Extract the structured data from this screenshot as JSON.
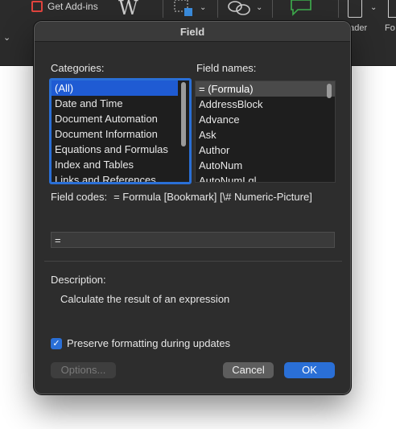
{
  "ribbon": {
    "add_ins_label": "Get Add-ins",
    "wikipedia_glyph": "W",
    "header_label": "eader",
    "footer_label": "Fo"
  },
  "dialog": {
    "title": "Field",
    "categories_label": "Categories:",
    "categories": [
      "(All)",
      "Date and Time",
      "Document Automation",
      "Document Information",
      "Equations and Formulas",
      "Index and Tables",
      "Links and References"
    ],
    "categories_selected": "(All)",
    "field_names_label": "Field names:",
    "field_names": [
      "= (Formula)",
      "AddressBlock",
      "Advance",
      "Ask",
      "Author",
      "AutoNum",
      "AutoNumLgl"
    ],
    "field_names_selected": "= (Formula)",
    "field_codes_label": "Field codes:",
    "field_codes_syntax": "= Formula [Bookmark] [\\# Numeric-Picture]",
    "field_code_value": "=",
    "description_label": "Description:",
    "description_text": "Calculate the result of an expression",
    "preserve_formatting_label": "Preserve formatting during updates",
    "preserve_formatting_checked": true,
    "options_button": "Options...",
    "cancel_button": "Cancel",
    "ok_button": "OK"
  },
  "colors": {
    "accent": "#2a6fd6",
    "dialog_bg": "#2d2d2d",
    "list_bg": "#1e1e1e"
  }
}
